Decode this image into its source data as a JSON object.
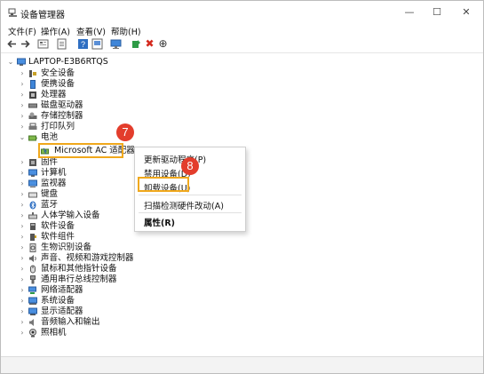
{
  "window": {
    "title": "设备管理器",
    "controls": {
      "minimize": "—",
      "maximize": "☐",
      "close": "✕"
    }
  },
  "menu": [
    "文件(F)",
    "操作(A)",
    "查看(V)",
    "帮助(H)"
  ],
  "toolbar": {
    "icons": [
      "back-icon",
      "forward-icon",
      "properties-icon",
      "print-icon",
      "help-icon",
      "show-hide-icon",
      "scan-icon",
      "update-driver-icon",
      "uninstall-icon",
      "disable-icon"
    ],
    "uninstall_glyph": "✖",
    "disable_glyph": "⊕"
  },
  "tree": {
    "root": {
      "caret": "⌄",
      "label": "LAPTOP-E3B6RTQS"
    },
    "items": [
      {
        "label": "安全设备",
        "caret": "›",
        "icon": "security-device-icon"
      },
      {
        "label": "便携设备",
        "caret": "›",
        "icon": "portable-device-icon"
      },
      {
        "label": "处理器",
        "caret": "›",
        "icon": "processor-icon"
      },
      {
        "label": "磁盘驱动器",
        "caret": "›",
        "icon": "disk-drive-icon"
      },
      {
        "label": "存储控制器",
        "caret": "›",
        "icon": "storage-controller-icon"
      },
      {
        "label": "打印队列",
        "caret": "›",
        "icon": "printer-icon"
      },
      {
        "label": "电池",
        "caret": "⌄",
        "icon": "battery-icon"
      },
      {
        "label": "Microsoft AC 适配器",
        "caret": "",
        "icon": "ac-adapter-icon",
        "child": true
      },
      {
        "label": "固件",
        "caret": "›",
        "icon": "firmware-icon"
      },
      {
        "label": "计算机",
        "caret": "›",
        "icon": "computer-icon"
      },
      {
        "label": "监视器",
        "caret": "›",
        "icon": "monitor-icon"
      },
      {
        "label": "键盘",
        "caret": "›",
        "icon": "keyboard-icon"
      },
      {
        "label": "蓝牙",
        "caret": "›",
        "icon": "bluetooth-icon"
      },
      {
        "label": "人体学输入设备",
        "caret": "›",
        "icon": "hid-icon"
      },
      {
        "label": "软件设备",
        "caret": "›",
        "icon": "software-device-icon"
      },
      {
        "label": "软件组件",
        "caret": "›",
        "icon": "software-component-icon"
      },
      {
        "label": "生物识别设备",
        "caret": "›",
        "icon": "biometric-icon"
      },
      {
        "label": "声音、视频和游戏控制器",
        "caret": "›",
        "icon": "sound-icon"
      },
      {
        "label": "鼠标和其他指针设备",
        "caret": "›",
        "icon": "mouse-icon"
      },
      {
        "label": "通用串行总线控制器",
        "caret": "›",
        "icon": "usb-icon"
      },
      {
        "label": "网络适配器",
        "caret": "›",
        "icon": "network-adapter-icon"
      },
      {
        "label": "系统设备",
        "caret": "›",
        "icon": "system-device-icon"
      },
      {
        "label": "显示适配器",
        "caret": "›",
        "icon": "display-adapter-icon"
      },
      {
        "label": "音频输入和输出",
        "caret": "›",
        "icon": "audio-io-icon"
      },
      {
        "label": "照相机",
        "caret": "›",
        "icon": "camera-icon"
      }
    ]
  },
  "context_menu": {
    "items": [
      {
        "label": "更新驱动程序(P)"
      },
      {
        "label": "禁用设备(D)"
      },
      {
        "label": "卸载设备(U)"
      },
      {
        "label": "扫描检测硬件改动(A)"
      },
      {
        "label": "属性(R)"
      }
    ]
  },
  "annotations": {
    "step1": "7",
    "step2": "8"
  },
  "colors": {
    "highlight": "#f0a81c",
    "step_badge": "#e33d2c",
    "tb_blue": "#2f6fc2",
    "tb_red": "#d42a1e",
    "tb_green": "#2e9b46"
  }
}
